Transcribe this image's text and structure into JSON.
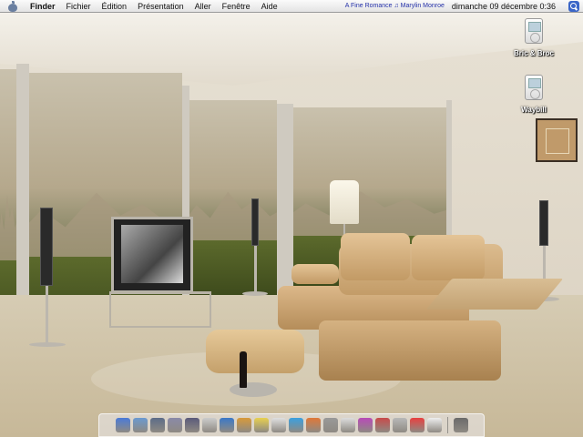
{
  "menubar": {
    "apple_icon": "apple-icon",
    "items": [
      "Finder",
      "Fichier",
      "Édition",
      "Présentation",
      "Aller",
      "Fenêtre",
      "Aide"
    ],
    "now_playing": "A Fine Romance ♫ Marylin Monroe",
    "clock": "dimanche 09 décembre 0:36",
    "spotlight_icon": "spotlight-icon"
  },
  "desktop": {
    "icons": [
      {
        "label": "Bric & Broc",
        "icon": "ipod-icon"
      },
      {
        "label": "Waybill",
        "icon": "ipod-icon"
      }
    ]
  },
  "dock": {
    "apps": [
      {
        "name": "finder-icon",
        "color": "#4a7ad8"
      },
      {
        "name": "itunes-icon",
        "color": "#6a9ad0"
      },
      {
        "name": "iphoto-icon",
        "color": "#5c6c88"
      },
      {
        "name": "preview-icon",
        "color": "#8a8aa8"
      },
      {
        "name": "garageband-icon",
        "color": "#5a5a7a"
      },
      {
        "name": "pages-icon",
        "color": "#cccccc"
      },
      {
        "name": "dictionary-icon",
        "color": "#3a78c8"
      },
      {
        "name": "graphic-converter-icon",
        "color": "#d89a3a"
      },
      {
        "name": "stickies-icon",
        "color": "#e8d050"
      },
      {
        "name": "textedit-icon",
        "color": "#e0e0e0"
      },
      {
        "name": "safari-icon",
        "color": "#3aa0e0"
      },
      {
        "name": "firefox-icon",
        "color": "#e07838"
      },
      {
        "name": "system-prefs-icon",
        "color": "#999999"
      },
      {
        "name": "ipod-updater-icon",
        "color": "#dddddd"
      },
      {
        "name": "dvd-player-icon",
        "color": "#b84ab8"
      },
      {
        "name": "preview-pdf-icon",
        "color": "#c84a4a"
      },
      {
        "name": "disk-utility-icon",
        "color": "#b8b8b8"
      },
      {
        "name": "ical-icon",
        "color": "#e84040"
      },
      {
        "name": "address-book-icon",
        "color": "#eeeeee"
      },
      {
        "name": "trash-icon",
        "color": "#6a6a6a"
      }
    ]
  }
}
